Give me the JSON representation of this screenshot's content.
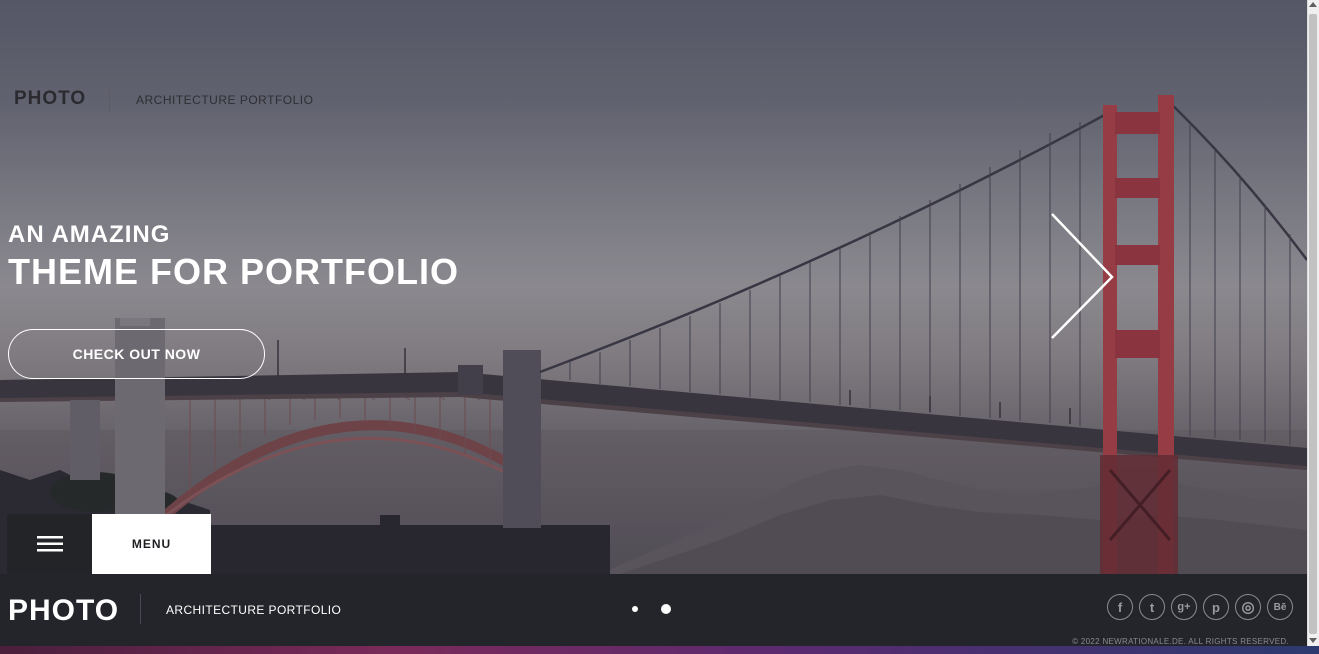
{
  "header": {
    "logo": "PHOTO",
    "tagline": "ARCHITECTURE PORTFOLIO"
  },
  "hero": {
    "headline_small": "AN AMAZING",
    "headline_large": "THEME FOR PORTFOLIO",
    "cta_label": "CHECK OUT NOW",
    "next_icon": "chevron-right-icon"
  },
  "menu": {
    "icon": "hamburger-icon",
    "label": "MENU"
  },
  "footer": {
    "logo": "PHOTO",
    "tagline": "ARCHITECTURE PORTFOLIO",
    "slider_dots": {
      "count": 2,
      "active_index": 1
    },
    "social": [
      {
        "name": "facebook-icon",
        "glyph": "f"
      },
      {
        "name": "twitter-icon",
        "glyph": "t"
      },
      {
        "name": "google-plus-icon",
        "glyph": "g+"
      },
      {
        "name": "pinterest-icon",
        "glyph": "p"
      },
      {
        "name": "dribbble-icon",
        "glyph": "◎"
      },
      {
        "name": "behance-icon",
        "glyph": "Bē"
      }
    ],
    "copyright": "© 2022 NEWRATIONALE.DE. ALL RIGHTS RESERVED."
  },
  "colors": {
    "footer_bg": "#24252a",
    "menu_icon_bg": "#232428",
    "menu_label_bg": "#ffffff",
    "bridge_red": "#a8424a",
    "text_light": "#ffffff"
  }
}
